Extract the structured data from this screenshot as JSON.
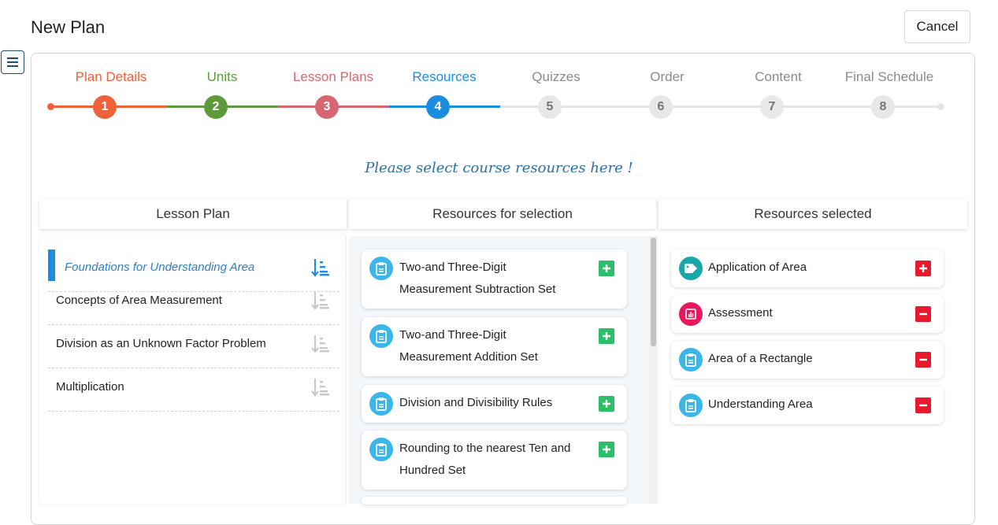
{
  "header": {
    "title": "New Plan",
    "cancel_label": "Cancel"
  },
  "stepper": {
    "steps": [
      {
        "label": "Plan Details",
        "number": "1",
        "color": "#f0613a",
        "state": "done"
      },
      {
        "label": "Units",
        "number": "2",
        "color": "#5d9a3c",
        "state": "done"
      },
      {
        "label": "Lesson Plans",
        "number": "3",
        "color": "#d86672",
        "state": "done"
      },
      {
        "label": "Resources",
        "number": "4",
        "color": "#1a8de0",
        "state": "current"
      },
      {
        "label": "Quizzes",
        "number": "5",
        "color": "#8a8a8a",
        "state": "todo"
      },
      {
        "label": "Order",
        "number": "6",
        "color": "#8a8a8a",
        "state": "todo"
      },
      {
        "label": "Content",
        "number": "7",
        "color": "#8a8a8a",
        "state": "todo"
      },
      {
        "label": "Final Schedule",
        "number": "8",
        "color": "#8a8a8a",
        "state": "todo"
      }
    ]
  },
  "instruction": "Please select course resources here !",
  "columns": {
    "lesson_plan": "Lesson Plan",
    "for_selection": "Resources for selection",
    "selected": "Resources selected"
  },
  "lesson_plans": [
    {
      "label": "Foundations for Understanding Area",
      "active": true
    },
    {
      "label": "Concepts of Area Measurement",
      "active": false
    },
    {
      "label": "Division as an Unknown Factor Problem",
      "active": false
    },
    {
      "label": "Multiplication",
      "active": false
    }
  ],
  "resources_for_selection": [
    {
      "line1": "Two-and Three-Digit",
      "line2": "Measurement Subtraction Set",
      "icon": "clipboard-icon"
    },
    {
      "line1": "Two-and Three-Digit",
      "line2": "Measurement Addition Set",
      "icon": "clipboard-icon"
    },
    {
      "line1": "Division and Divisibility Rules",
      "line2": "",
      "icon": "clipboard-icon"
    },
    {
      "line1": "Rounding to the nearest Ten and",
      "line2": "Hundred Set",
      "icon": "clipboard-icon"
    }
  ],
  "resources_selected": [
    {
      "label": "Application of Area",
      "icon": "tag-icon",
      "icon_color": "#1aa7a7",
      "action": "add"
    },
    {
      "label": "Assessment",
      "icon": "chart-icon",
      "icon_color": "#e8185d",
      "action": "remove"
    },
    {
      "label": "Area of a Rectangle",
      "icon": "clipboard-icon",
      "icon_color": "#3bb6e8",
      "action": "remove"
    },
    {
      "label": "Understanding Area",
      "icon": "clipboard-icon",
      "icon_color": "#3bb6e8",
      "action": "remove"
    }
  ],
  "colors": {
    "add_green": "#2dbf67",
    "remove_red": "#e8192c",
    "accent_blue": "#1a8de0"
  }
}
